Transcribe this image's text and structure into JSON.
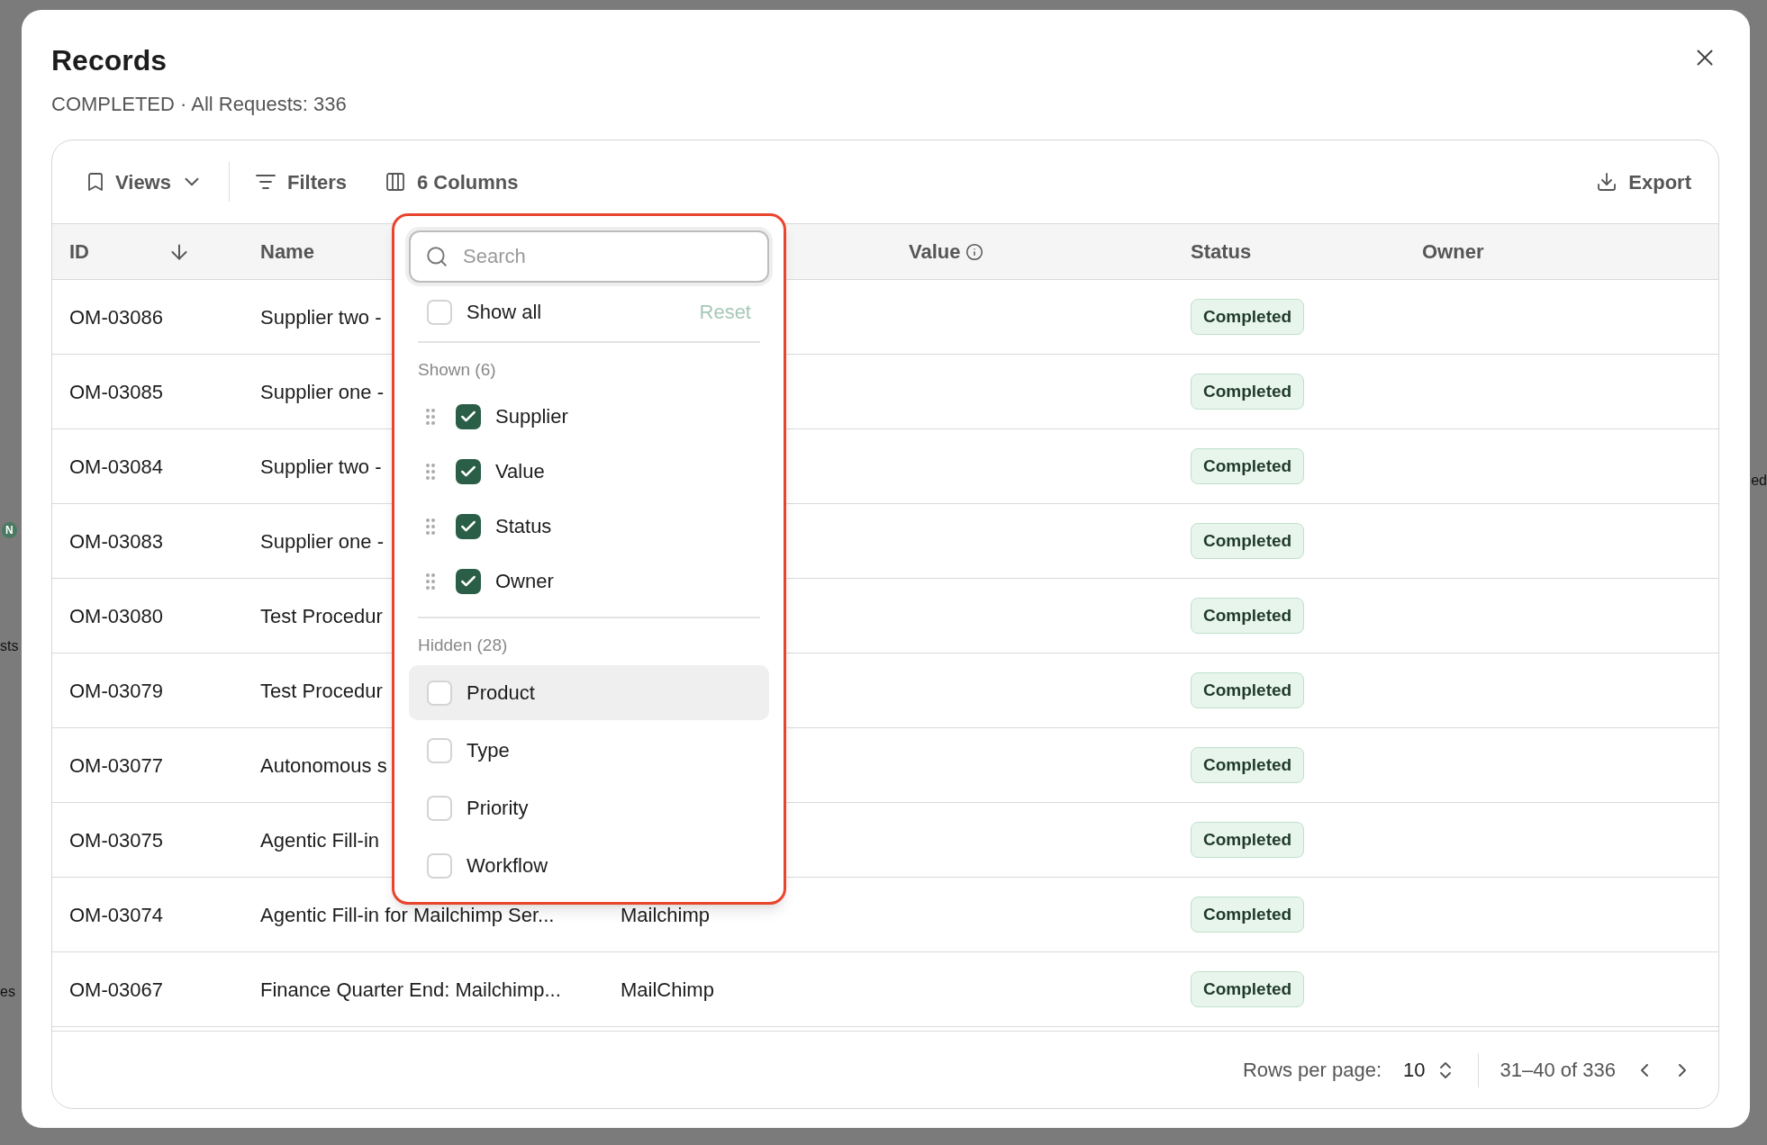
{
  "background_page": {
    "texts": [
      {
        "text": "N",
        "kind": "badge"
      },
      {
        "text": "sts",
        "kind": "text"
      },
      {
        "text": "es",
        "kind": "text"
      },
      {
        "text": "ed",
        "kind": "text"
      }
    ]
  },
  "dialog": {
    "title": "Records",
    "subtitle": "COMPLETED · All Requests: 336"
  },
  "toolbar": {
    "views": "Views",
    "filters": "Filters",
    "columns": "6 Columns",
    "export": "Export"
  },
  "table": {
    "columns": [
      {
        "label": "ID",
        "sorted": true,
        "info": false
      },
      {
        "label": "Name",
        "sorted": false,
        "info": false
      },
      {
        "label": "Value",
        "sorted": false,
        "info": true
      },
      {
        "label": "Status",
        "sorted": false,
        "info": false
      },
      {
        "label": "Owner",
        "sorted": false,
        "info": false
      }
    ],
    "rows": [
      {
        "id": "OM-03086",
        "name": "Supplier two -",
        "status": "Completed"
      },
      {
        "id": "OM-03085",
        "name": "Supplier one -",
        "status": "Completed"
      },
      {
        "id": "OM-03084",
        "name": "Supplier two -",
        "status": "Completed"
      },
      {
        "id": "OM-03083",
        "name": "Supplier one -",
        "status": "Completed"
      },
      {
        "id": "OM-03080",
        "name": "Test Procedur",
        "status": "Completed"
      },
      {
        "id": "OM-03079",
        "name": "Test Procedur",
        "status": "Completed"
      },
      {
        "id": "OM-03077",
        "name": "Autonomous s",
        "status": "Completed"
      },
      {
        "id": "OM-03075",
        "name": "Agentic Fill-in",
        "status": "Completed"
      },
      {
        "id": "OM-03074",
        "name": "Agentic Fill-in for Mailchimp Ser...",
        "column_3": "Mailchimp",
        "status": "Completed"
      },
      {
        "id": "OM-03067",
        "name": "Finance Quarter End: Mailchimp...",
        "column_3": "MailChimp",
        "status": "Completed"
      }
    ]
  },
  "column_menu": {
    "search": {
      "placeholder": "Search"
    },
    "show_all": {
      "label": "Show all",
      "checked": false
    },
    "reset": "Reset",
    "groups": [
      {
        "title": "Shown (6)",
        "items": [
          {
            "label": "Supplier",
            "checked": true,
            "draggable": true,
            "selected": false
          },
          {
            "label": "Value",
            "checked": true,
            "draggable": true,
            "selected": false
          },
          {
            "label": "Status",
            "checked": true,
            "draggable": true,
            "selected": false
          },
          {
            "label": "Owner",
            "checked": true,
            "draggable": true,
            "selected": false
          }
        ]
      },
      {
        "title": "Hidden (28)",
        "items": [
          {
            "label": "Product",
            "checked": false,
            "draggable": false,
            "selected": true
          },
          {
            "label": "Type",
            "checked": false,
            "draggable": false,
            "selected": false
          },
          {
            "label": "Priority",
            "checked": false,
            "draggable": false,
            "selected": false
          },
          {
            "label": "Workflow",
            "checked": false,
            "draggable": false,
            "selected": false
          }
        ]
      }
    ]
  },
  "pagination": {
    "rows_per_page_label": "Rows per page:",
    "rows_per_page": "10",
    "range": "31–40 of 336"
  }
}
